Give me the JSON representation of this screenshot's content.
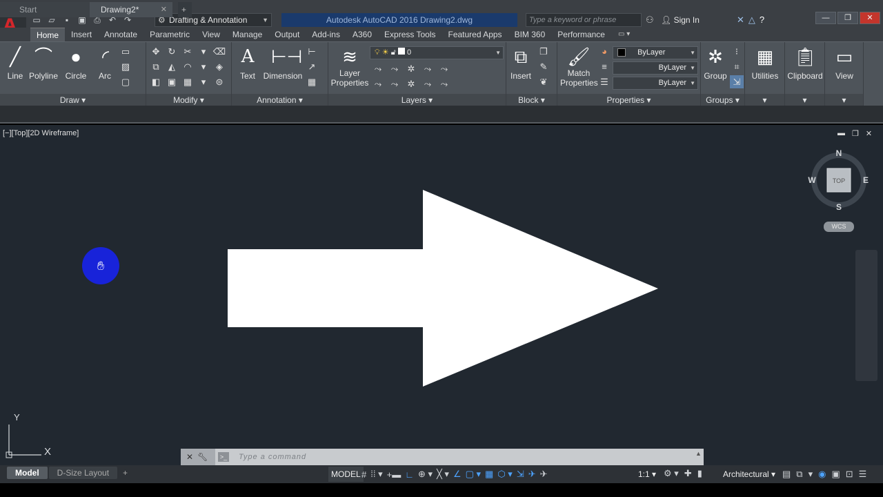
{
  "app": {
    "title": "Autodesk AutoCAD 2016    Drawing2.dwg",
    "workspace": "Drafting & Annotation",
    "search_placeholder": "Type a keyword or phrase",
    "sign_in": "Sign In",
    "logo_letter": "A"
  },
  "ribbon_tabs": [
    "Home",
    "Insert",
    "Annotate",
    "Parametric",
    "View",
    "Manage",
    "Output",
    "Add-ins",
    "A360",
    "Express Tools",
    "Featured Apps",
    "BIM 360",
    "Performance"
  ],
  "panels": {
    "draw": {
      "title": "Draw",
      "line": "Line",
      "polyline": "Polyline",
      "circle": "Circle",
      "arc": "Arc"
    },
    "modify": {
      "title": "Modify"
    },
    "annotation": {
      "title": "Annotation",
      "text": "Text",
      "dimension": "Dimension"
    },
    "layers": {
      "title": "Layers",
      "layer_properties": "Layer Properties",
      "current_layer": "0"
    },
    "block": {
      "title": "Block",
      "insert": "Insert"
    },
    "properties": {
      "title": "Properties",
      "match_properties": "Match Properties",
      "color": "ByLayer",
      "linetype": "ByLayer",
      "lineweight": "ByLayer"
    },
    "groups": {
      "title": "Groups",
      "group": "Group"
    },
    "utilities": {
      "label": "Utilities"
    },
    "clipboard": {
      "label": "Clipboard"
    },
    "view": {
      "label": "View"
    }
  },
  "file_tabs": {
    "start": "Start",
    "drawing": "Drawing2*"
  },
  "viewport": {
    "label": "[−][Top][2D Wireframe]",
    "compass": {
      "n": "N",
      "s": "S",
      "e": "E",
      "w": "W",
      "top": "TOP"
    },
    "wcs": "WCS",
    "ucs_x": "X",
    "ucs_y": "Y"
  },
  "command": {
    "placeholder": "Type  a  command"
  },
  "status": {
    "layout_tabs": [
      "Model",
      "D-Size Layout"
    ],
    "model": "MODEL",
    "scale": "1:1",
    "units": "Architectural"
  },
  "colors": {
    "accent": "#1a3a6c",
    "viewport_bg": "#212830",
    "arrow_fill": "#ffffff",
    "cursor_circle": "#1823d9",
    "logo_red": "#d3262b"
  }
}
